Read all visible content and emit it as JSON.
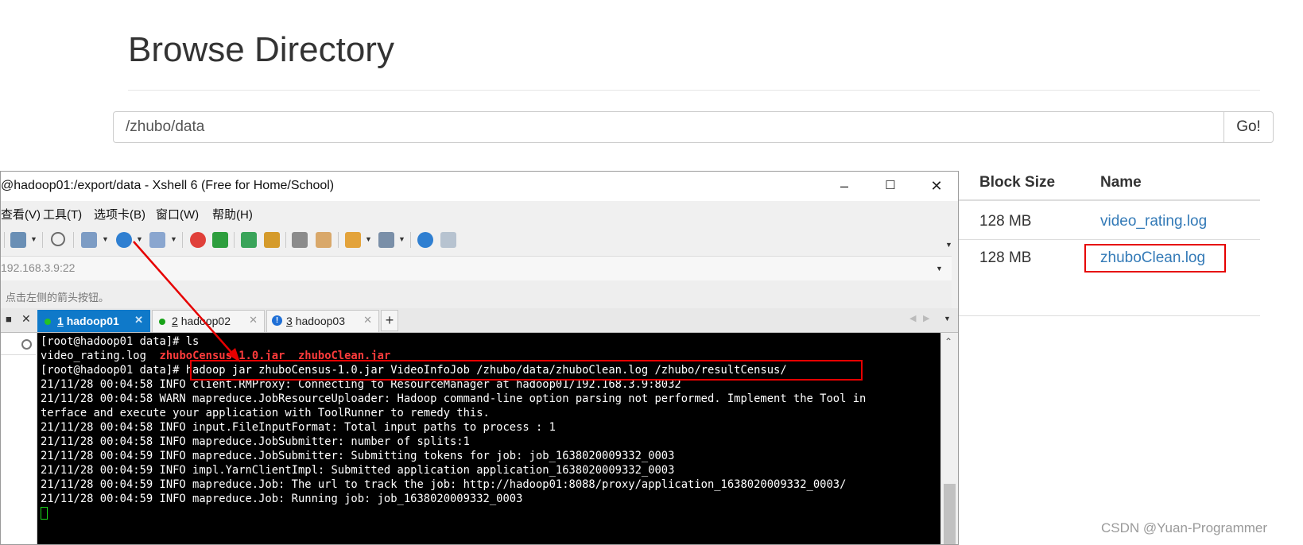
{
  "browser": {
    "page_title": "Browse Directory",
    "path_value": "/zhubo/data",
    "go_label": "Go!",
    "table": {
      "headers": [
        "Block Size",
        "Name"
      ],
      "rows": [
        {
          "block_size": "128 MB",
          "name": "video_rating.log"
        },
        {
          "block_size": "128 MB",
          "name": "zhuboClean.log"
        }
      ]
    }
  },
  "xshell": {
    "title": "@hadoop01:/export/data - Xshell 6 (Free for Home/School)",
    "menus": [
      "查看(V)",
      "工具(T)",
      "选项卡(B)",
      "窗口(W)",
      "帮助(H)"
    ],
    "address": "192.168.3.9:22",
    "hint": "点击左侧的箭头按钮。",
    "tabs": [
      {
        "num": "1",
        "label": "hadoop01",
        "status": "connected",
        "active": true
      },
      {
        "num": "2",
        "label": "hadoop02",
        "status": "connected",
        "active": false
      },
      {
        "num": "3",
        "label": "hadoop03",
        "status": "warning",
        "active": false
      }
    ],
    "terminal": {
      "line1": "[root@hadoop01 data]# ls",
      "line2_plain": "video_rating.log  ",
      "line2_red": "zhuboCensus-1.0.jar  zhuboClean.jar",
      "line3": "[root@hadoop01 data]# hadoop jar zhuboCensus-1.0.jar VideoInfoJob /zhubo/data/zhuboClean.log /zhubo/resultCensus/",
      "line4": "21/11/28 00:04:58 INFO client.RMProxy: Connecting to ResourceManager at hadoop01/192.168.3.9:8032",
      "line5": "21/11/28 00:04:58 WARN mapreduce.JobResourceUploader: Hadoop command-line option parsing not performed. Implement the Tool in",
      "line6": "terface and execute your application with ToolRunner to remedy this.",
      "line7": "21/11/28 00:04:58 INFO input.FileInputFormat: Total input paths to process : 1",
      "line8": "21/11/28 00:04:58 INFO mapreduce.JobSubmitter: number of splits:1",
      "line9": "21/11/28 00:04:59 INFO mapreduce.JobSubmitter: Submitting tokens for job: job_1638020009332_0003",
      "line10": "21/11/28 00:04:59 INFO impl.YarnClientImpl: Submitted application application_1638020009332_0003",
      "line11": "21/11/28 00:04:59 INFO mapreduce.Job: The url to track the job: http://hadoop01:8088/proxy/application_1638020009332_0003/",
      "line12": "21/11/28 00:04:59 INFO mapreduce.Job: Running job: job_1638020009332_0003"
    }
  },
  "watermark": "CSDN @Yuan-Programmer",
  "colors": {
    "link": "#337ab7",
    "highlight": "#e60000",
    "tab_active": "#0f79c9",
    "terminal_bg": "#000000"
  }
}
